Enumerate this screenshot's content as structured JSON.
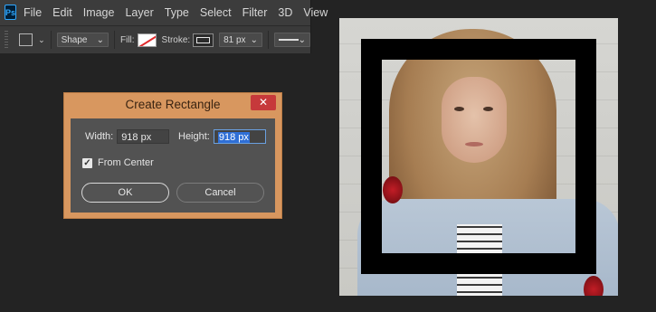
{
  "app": {
    "logo_text": "Ps"
  },
  "menu": [
    "File",
    "Edit",
    "Image",
    "Layer",
    "Type",
    "Select",
    "Filter",
    "3D",
    "View"
  ],
  "options": {
    "mode": "Shape",
    "fill_label": "Fill:",
    "stroke_label": "Stroke:",
    "stroke_width": "81 px"
  },
  "dialog": {
    "title": "Create Rectangle",
    "close": "✕",
    "width_label": "Width:",
    "width_value": "918 px",
    "height_label": "Height:",
    "height_value": "918 px",
    "from_center_label": "From Center",
    "from_center_checked": true,
    "ok_label": "OK",
    "cancel_label": "Cancel"
  },
  "colors": {
    "dialog_frame": "#d8975f",
    "close_button": "#c6393b",
    "selection": "#2f6fd6"
  },
  "icons": {
    "shape_tool": "rectangle-icon",
    "fill": "no-fill-swatch-icon",
    "stroke": "stroke-swatch-icon",
    "stroke_type": "solid-line-icon"
  }
}
